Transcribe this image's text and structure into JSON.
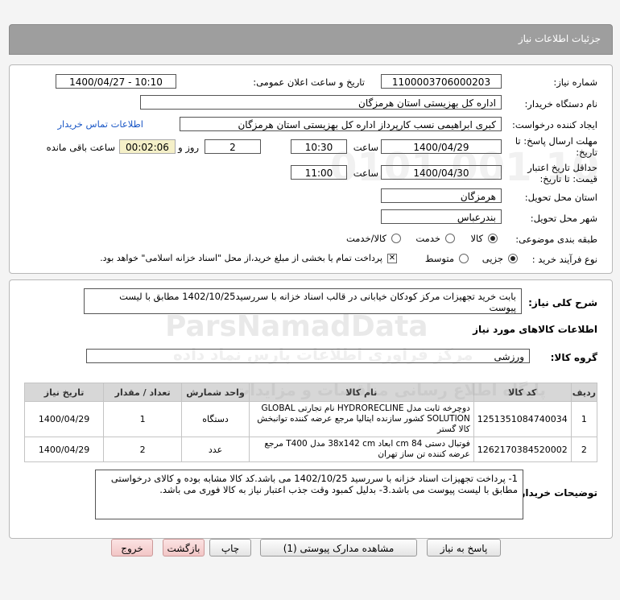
{
  "header": {
    "title": "جزئیات اطلاعات نیاز"
  },
  "fields": {
    "need_number_label": "شماره نیاز:",
    "need_number": "1100003706000203",
    "announce_label": "تاریخ و ساعت اعلان عمومی:",
    "announce_value": "1400/04/27 - 10:10",
    "buyer_label": "نام دستگاه خریدار:",
    "buyer_value": "اداره کل بهزیستی استان هرمزگان",
    "creator_label": "ایجاد کننده درخواست:",
    "creator_value": "کبری  ابراهیمی نسب کارپرداز اداره کل بهزیستی استان هرمزگان",
    "contact_link": "اطلاعات تماس خریدار",
    "deadline_label_1": "مهلت ارسال پاسخ: تا",
    "deadline_label_2": "تاریخ:",
    "deadline_date": "1400/04/29",
    "time_label": "ساعت",
    "deadline_time": "10:30",
    "days_value": "2",
    "days_label": "روز و",
    "remaining_time": "00:02:06",
    "remaining_label": "ساعت باقی مانده",
    "validity_label_1": "حداقل تاریخ اعتبار",
    "validity_label_2": "قیمت: تا تاریخ:",
    "validity_date": "1400/04/30",
    "validity_time_label": "ساعت",
    "validity_time": "11:00",
    "province_label": "استان محل تحویل:",
    "province_value": "هرمزگان",
    "city_label": "شهر محل تحویل:",
    "city_value": "بندرعباس",
    "category_label": "طبقه بندی موضوعی:",
    "category_options": [
      "کالا",
      "خدمت",
      "کالا/خدمت"
    ],
    "process_label": "نوع فرآیند خرید :",
    "process_options": [
      "جزیی",
      "متوسط"
    ],
    "payment_note": "پرداخت تمام یا بخشی از مبلغ خرید،از محل \"اسناد خزانه اسلامی\" خواهد بود."
  },
  "summary": {
    "label": "شرح کلی نیاز:",
    "text": "بابت خرید تجهیزات مرکز کودکان خیابانی در قالب اسناد خزانه با سررسید1402/10/25 مطابق با لیست پیوست"
  },
  "goods": {
    "section_title": "اطلاعات کالاهای مورد نیاز",
    "group_label": "گروه کالا:",
    "group_value": "ورزشی",
    "columns": [
      "ردیف",
      "کد کالا",
      "نام کالا",
      "واحد شمارش",
      "تعداد / مقدار",
      "تاریخ نیاز"
    ],
    "rows": [
      {
        "index": "1",
        "code": "1251351084740034",
        "name": "دوچرخه ثابت مدل HYDRORECLINE نام تجارتی GLOBAL SOLUTION کشور سازنده ایتالیا مرجع عرضه کننده توانبخش کالا گستر",
        "unit": "دستگاه",
        "qty": "1",
        "date": "1400/04/29"
      },
      {
        "index": "2",
        "code": "1262170384520002",
        "name": "فوتبال دستی 84 cm ابعاد 38x142 cm مدل T400 مرجع عرضه کننده تن ساز تهران",
        "unit": "عدد",
        "qty": "2",
        "date": "1400/04/29"
      }
    ]
  },
  "buyer_notes": {
    "label": "توضیحات خریدار:",
    "text": "1- پرداخت تجهیزات اسناد خزانه با سررسید 1402/10/25 می باشد.کد کالا مشابه بوده و کالای درخواستی مطابق با لیست پیوست می باشد.3- بدلیل کمبود وقت جذب اعتبار نیاز به کالا فوری می باشد."
  },
  "buttons": {
    "reply": "پاسخ به نیاز",
    "attachments": "مشاهده مدارک پیوستی (1)",
    "print": "چاپ",
    "back": "بازگشت",
    "exit": "خروج"
  },
  "watermark": {
    "brand": "ParsNamadData",
    "line1": "مرکز فراوری اطلاعات پارس نماد داده",
    "line2": "پایگاه اطلاع رسانی مناقصات و مزایدات",
    "digits": "0101 001 10"
  }
}
